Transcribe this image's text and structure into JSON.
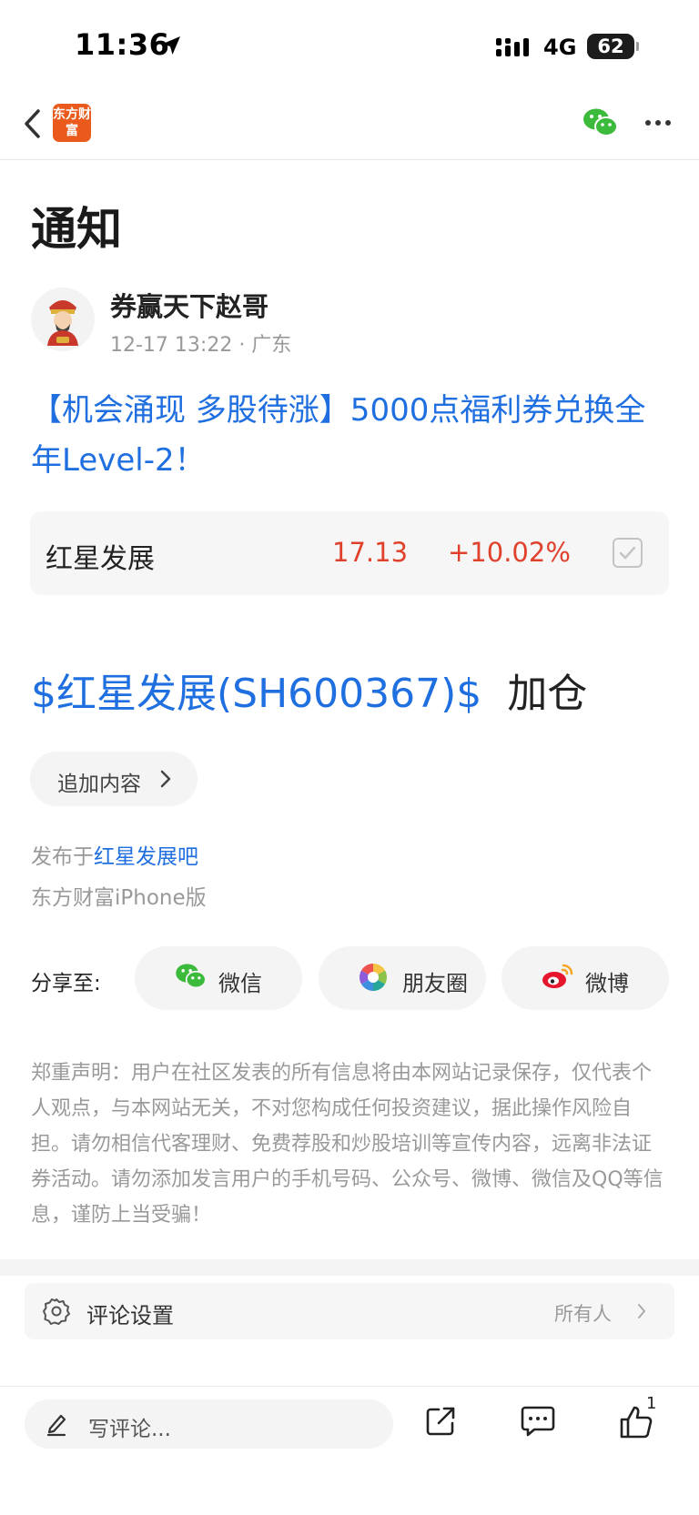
{
  "status_bar": {
    "time": "11:36",
    "network": "4G",
    "battery": "62"
  },
  "nav": {
    "app_logo_text": "东方财富"
  },
  "page_title": "通知",
  "post": {
    "author": "券赢天下赵哥",
    "meta": "12-17 13:22  · 广东",
    "headline": "【机会涌现 多股待涨】5000点福利券兑换全年Level-2！"
  },
  "stock_card": {
    "name": "红星发展",
    "price": "17.13",
    "change": "+10.02%"
  },
  "stock_line": {
    "link": "$红星发展(SH600367)$",
    "action": "加仓"
  },
  "append_label": "追加内容",
  "posted_in": {
    "prefix": "发布于",
    "bar_name": "红星发展吧"
  },
  "platform": "东方财富iPhone版",
  "share": {
    "label": "分享至:",
    "options": [
      {
        "label": "微信",
        "icon": "wechat-icon"
      },
      {
        "label": "朋友圈",
        "icon": "moments-icon"
      },
      {
        "label": "微博",
        "icon": "weibo-icon"
      }
    ]
  },
  "disclaimer": "郑重声明：用户在社区发表的所有信息将由本网站记录保存，仅代表个人观点，与本网站无关，不对您构成任何投资建议，据此操作风险自担。请勿相信代客理财、免费荐股和炒股培训等宣传内容，远离非法证券活动。请勿添加发言用户的手机号码、公众号、微博、微信及QQ等信息，谨防上当受骗！",
  "comment_setting": {
    "label": "评论设置",
    "value": "所有人"
  },
  "bottom_bar": {
    "placeholder": "写评论...",
    "like_count": "1"
  },
  "colors": {
    "link_blue": "#1f6fe0",
    "rise_red": "#e0412c",
    "brand_orange": "#ea5a1c"
  }
}
